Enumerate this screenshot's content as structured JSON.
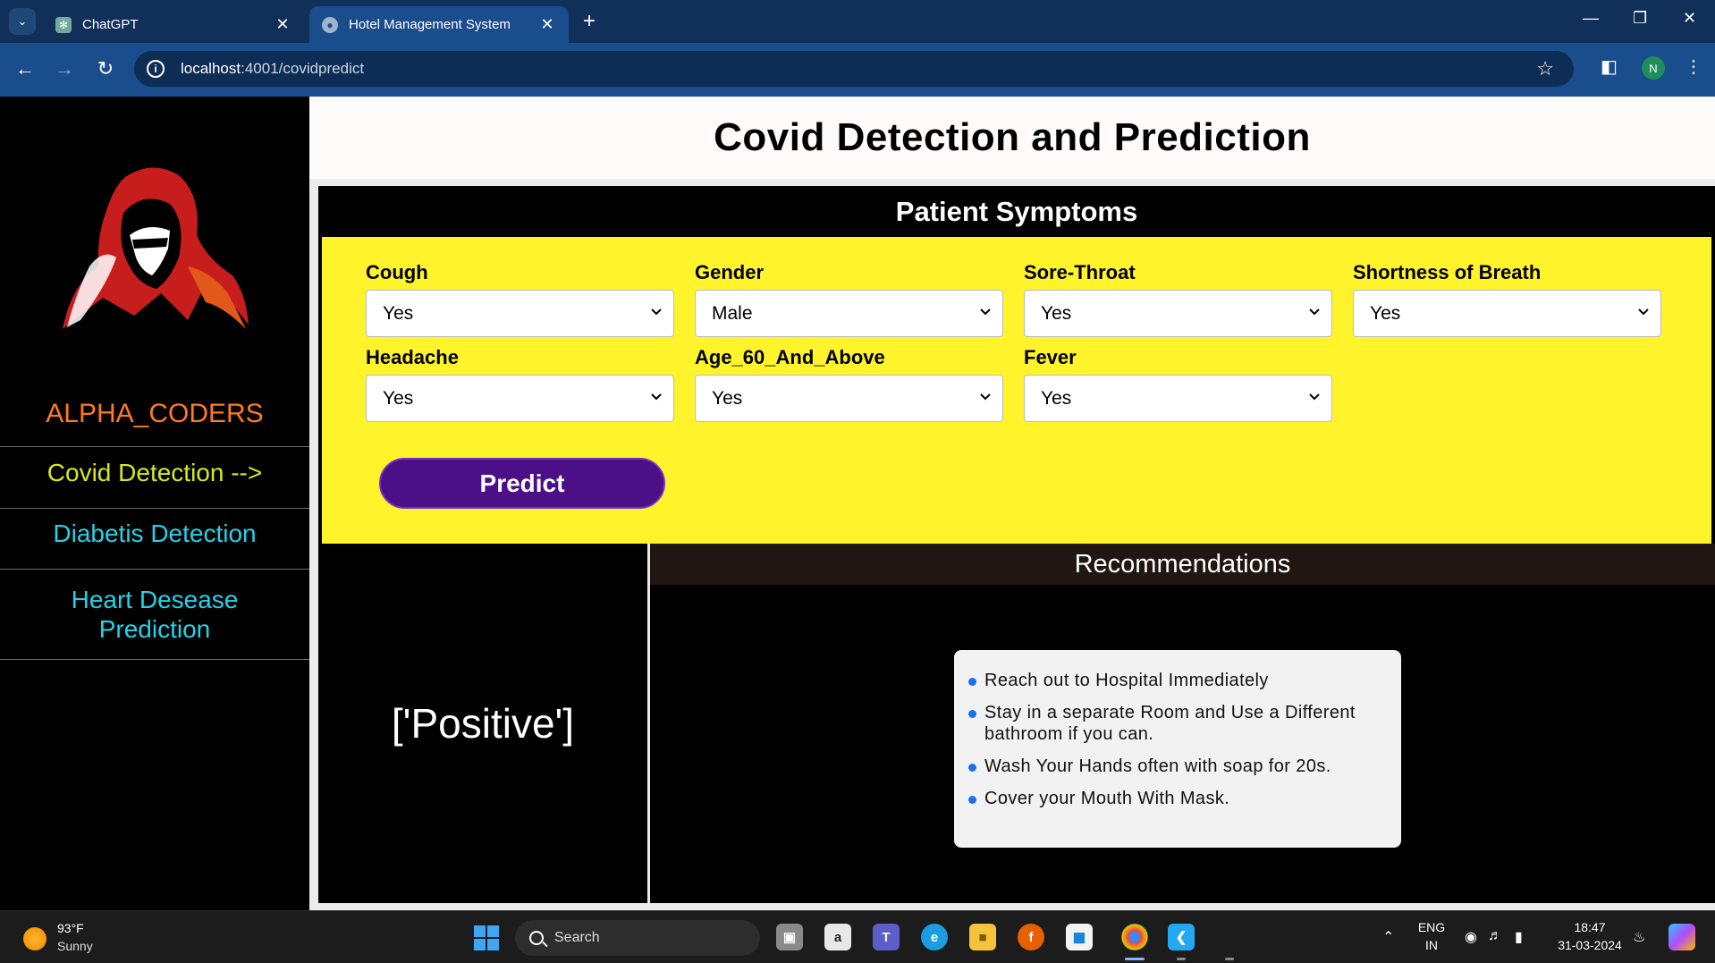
{
  "browser": {
    "tabs": [
      {
        "title": "ChatGPT",
        "active": false
      },
      {
        "title": "Hotel Management System",
        "active": true
      }
    ],
    "url_host": "localhost",
    "url_path": ":4001/covidpredict",
    "profile_initial": "N"
  },
  "sidebar": {
    "brand": "ALPHA_CODERS",
    "items": [
      {
        "label": "Covid Detection -->",
        "active": true
      },
      {
        "label": "Diabetis Detection",
        "active": false
      },
      {
        "label": "Heart Desease Prediction",
        "active": false
      }
    ]
  },
  "page": {
    "title": "Covid Detection and Prediction",
    "panel_title": "Patient Symptoms",
    "fields": [
      {
        "label": "Cough",
        "value": "Yes"
      },
      {
        "label": "Gender",
        "value": "Male"
      },
      {
        "label": "Sore-Throat",
        "value": "Yes"
      },
      {
        "label": "Shortness of Breath",
        "value": "Yes"
      },
      {
        "label": "Headache",
        "value": "Yes"
      },
      {
        "label": "Age_60_And_Above",
        "value": "Yes"
      },
      {
        "label": "Fever",
        "value": "Yes"
      }
    ],
    "predict_label": "Predict",
    "result": "['Positive']",
    "recommendations_title": "Recommendations",
    "recommendations": [
      "Reach out to Hospital Immediately",
      "Stay in a separate Room and Use a Different bathroom if you can.",
      "Wash Your Hands often with soap for 20s.",
      "Cover your Mouth With Mask."
    ]
  },
  "taskbar": {
    "weather_temp": "93°F",
    "weather_desc": "Sunny",
    "search_label": "Search",
    "lang_top": "ENG",
    "lang_bottom": "IN",
    "time": "18:47",
    "date": "31-03-2024"
  },
  "colors": {
    "sidebar_accent": "#ff7a1f",
    "active_nav": "#d6ea1a",
    "nav_link": "#23d3e8",
    "form_bg": "#fff42b",
    "predict_btn": "#4b0f87"
  }
}
